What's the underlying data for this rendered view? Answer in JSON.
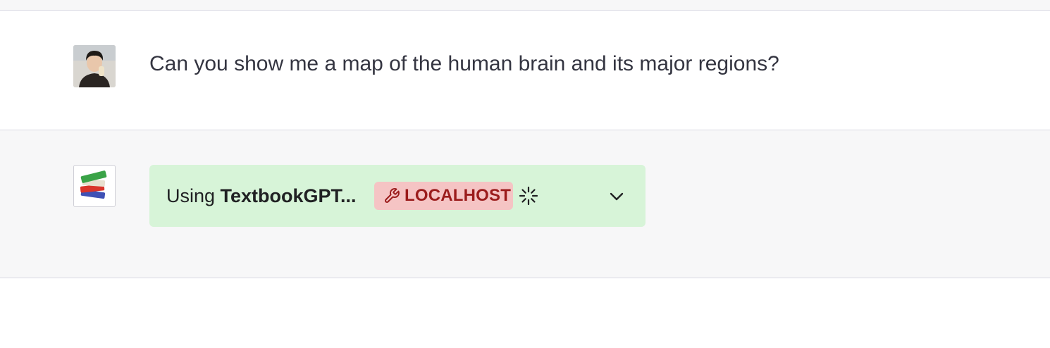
{
  "conversation": {
    "user_message": {
      "text": "Can you show me a map of the human brain and its major regions?",
      "avatar_icon": "user-photo-avatar"
    },
    "assistant_message": {
      "avatar_icon": "books-icon",
      "plugin_status": {
        "prefix": "Using ",
        "plugin_name": "TextbookGPT...",
        "badge_label": "LOCALHOST",
        "badge_icon": "wrench-icon",
        "state_icon": "loading-spinner-icon",
        "expand_icon": "chevron-down-icon"
      }
    }
  },
  "colors": {
    "plugin_bg": "#d7f4d8",
    "badge_bg": "#f5c4c4",
    "badge_text": "#9b1c1c",
    "assistant_row_bg": "#f7f7f8",
    "text_primary": "#343541"
  }
}
